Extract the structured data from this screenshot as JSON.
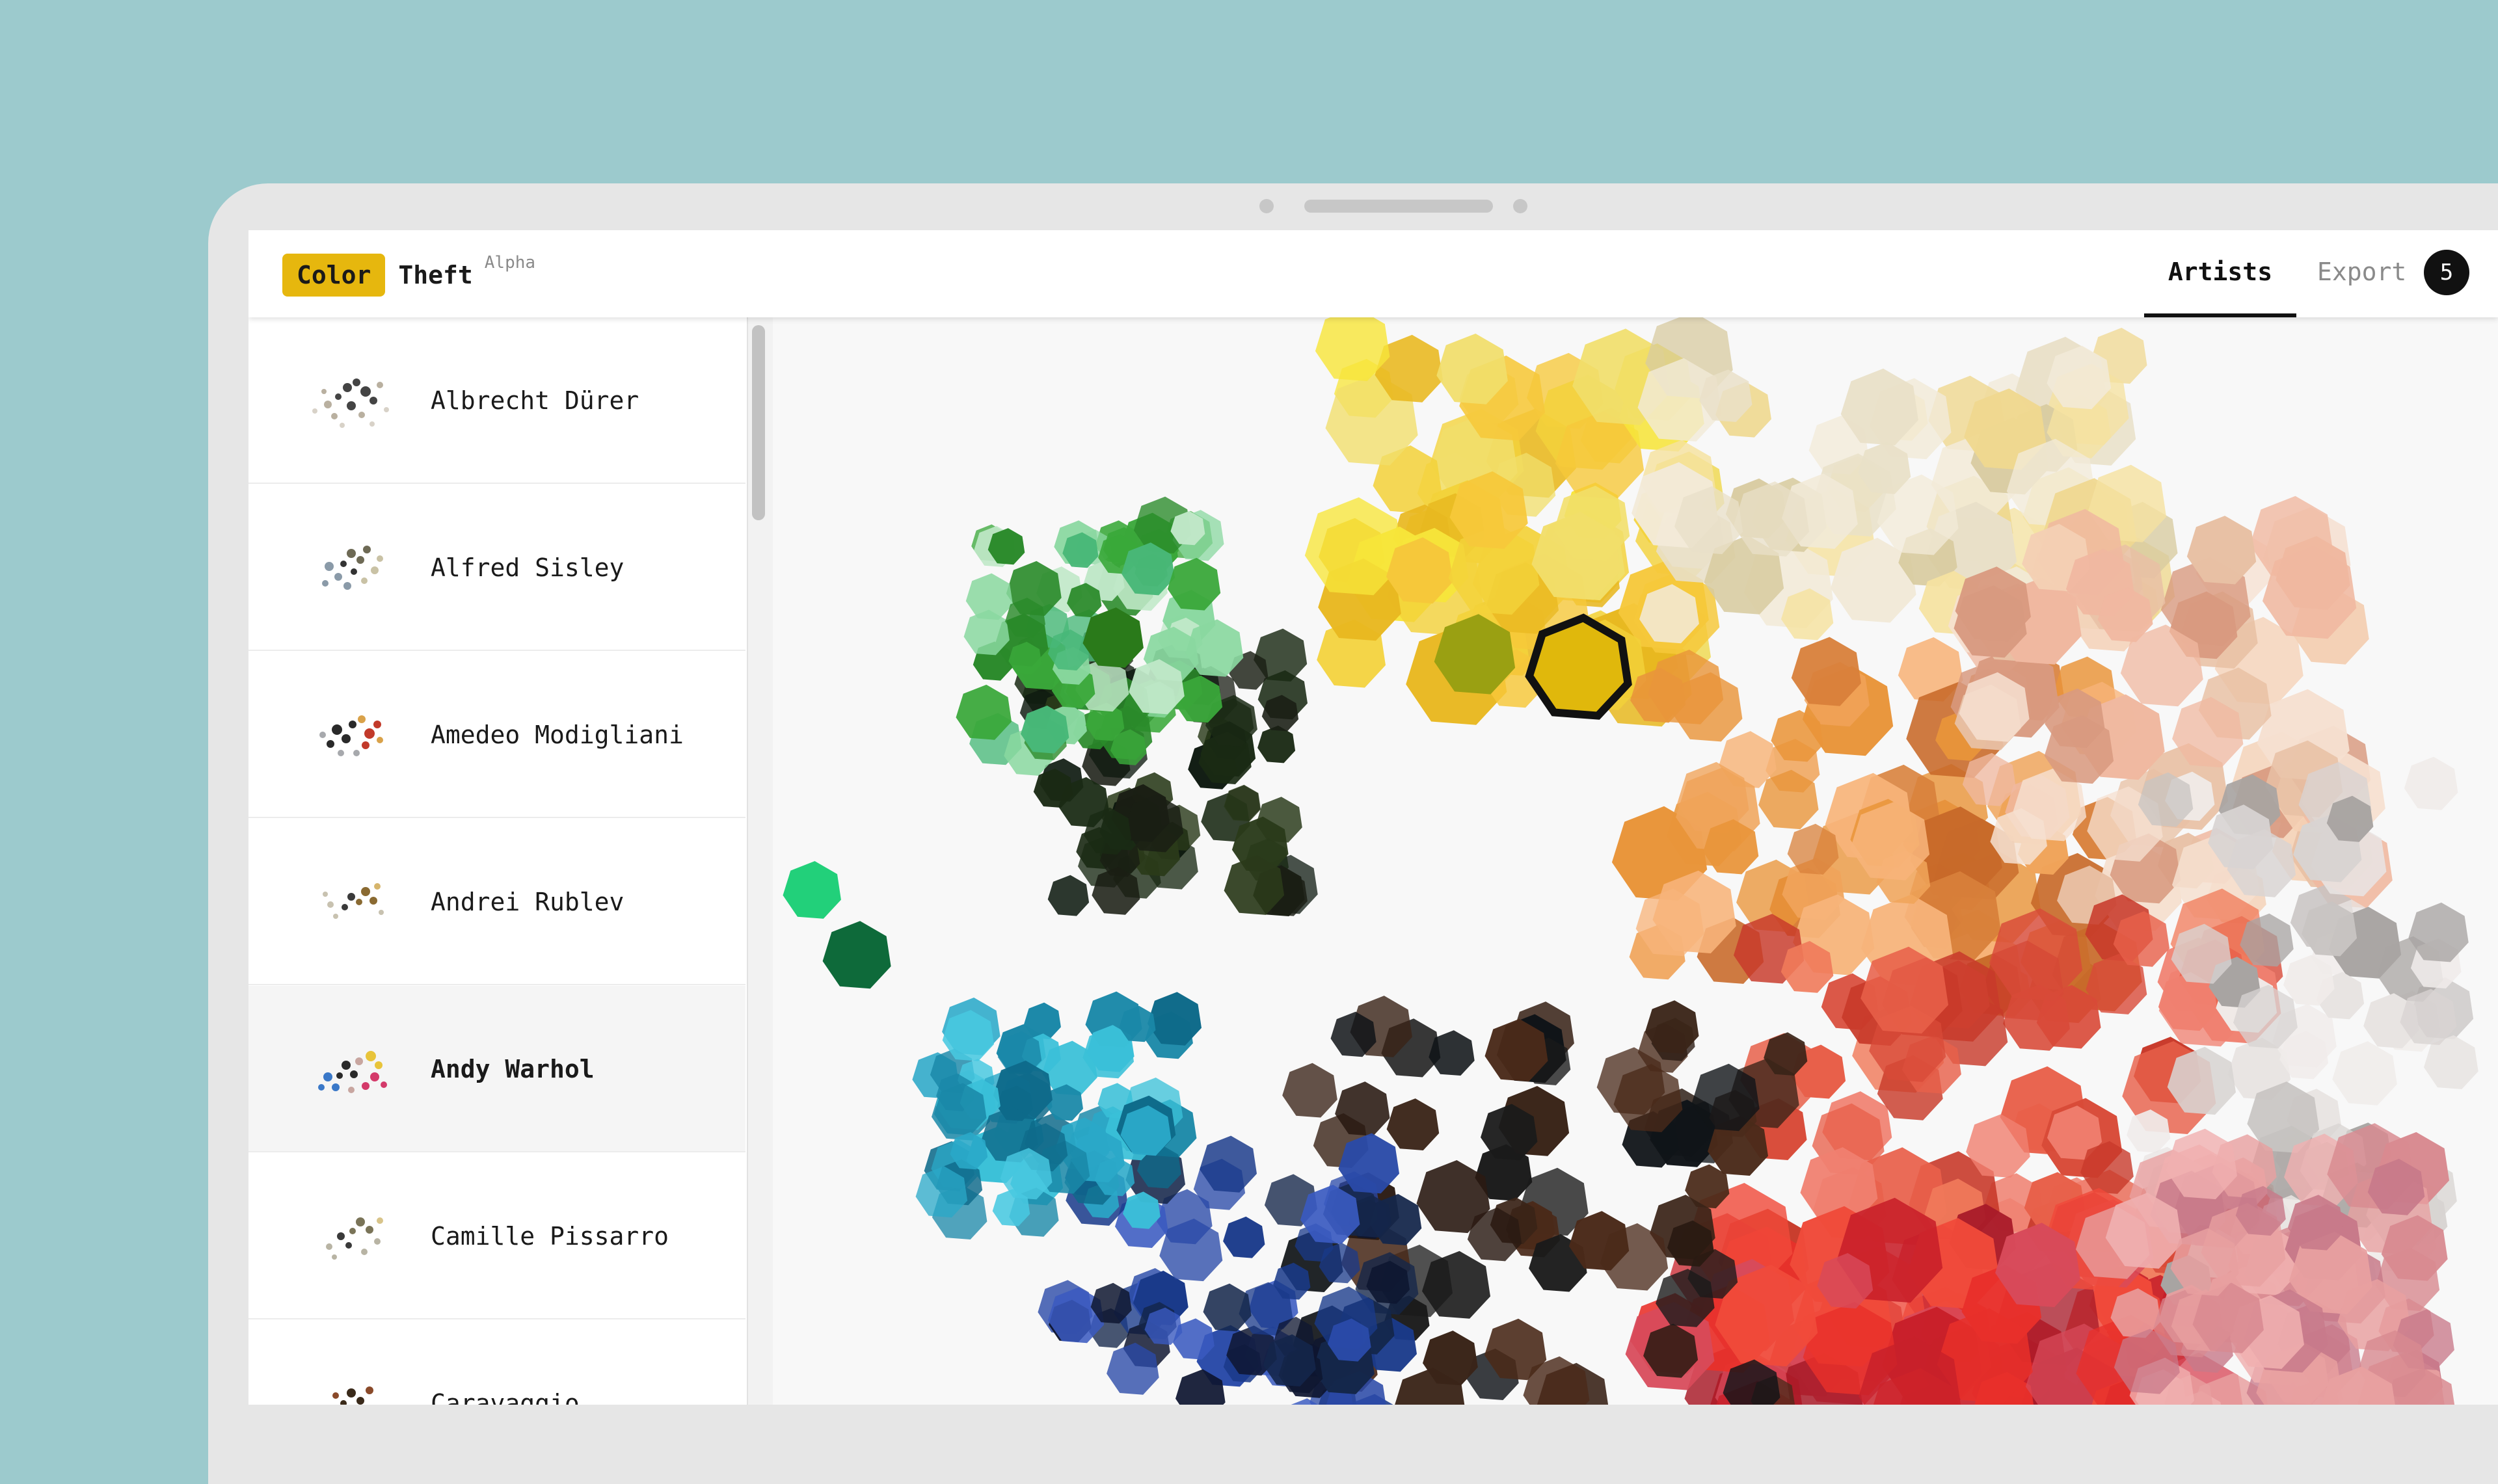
{
  "header": {
    "logo_word": "Color",
    "logo_suffix": "Theft",
    "release_badge": "Alpha",
    "accent_color": "#e6b70e"
  },
  "nav": {
    "tabs": [
      {
        "label": "Artists",
        "active": true
      },
      {
        "label": "Export",
        "active": false,
        "count": "5"
      }
    ]
  },
  "sidebar": {
    "selected": "Andy Warhol",
    "artists": [
      {
        "name": "Albrecht Dürer"
      },
      {
        "name": "Alfred Sisley"
      },
      {
        "name": "Amedeo Modigliani"
      },
      {
        "name": "Andrei Rublev"
      },
      {
        "name": "Andy Warhol"
      },
      {
        "name": "Camille Pissarro"
      },
      {
        "name": "Caravaggio"
      }
    ]
  },
  "visualization": {
    "description_icon": "color-cloud-3d",
    "highlighted_swatch": "#e0b80c"
  }
}
